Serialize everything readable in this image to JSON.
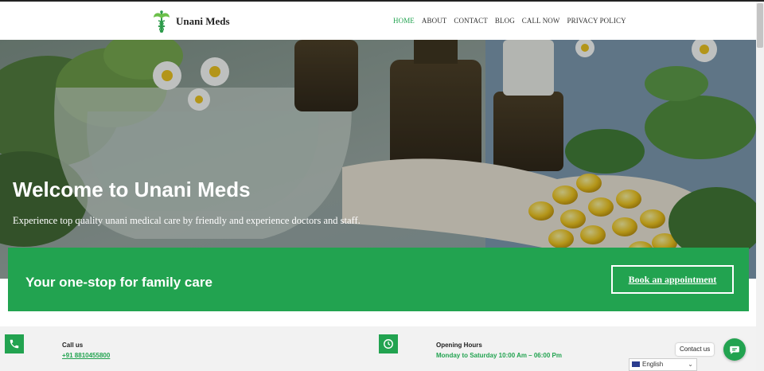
{
  "header": {
    "brand": "Unani Meds",
    "nav": [
      {
        "label": "HOME",
        "active": true
      },
      {
        "label": "ABOUT",
        "active": false
      },
      {
        "label": "CONTACT",
        "active": false
      },
      {
        "label": "BLOG",
        "active": false
      },
      {
        "label": "CALL NOW",
        "active": false
      },
      {
        "label": "PRIVACY POLICY",
        "active": false
      }
    ]
  },
  "hero": {
    "title": "Welcome to Unani Meds",
    "subtitle": "Experience top quality unani medical care by friendly and experience doctors and staff."
  },
  "cta": {
    "text": "Your one-stop for family care",
    "button": "Book an appointment"
  },
  "info": {
    "call": {
      "label": "Call us",
      "value": "+91 8810455800",
      "icon": "phone-icon"
    },
    "hours": {
      "label": "Opening Hours",
      "value": "Monday to Saturday 10:00 Am – 06:00 Pm",
      "icon": "clock-icon"
    }
  },
  "widgets": {
    "contact_label": "Contact us",
    "language": "English"
  },
  "colors": {
    "accent": "#22a350",
    "text": "#222222"
  }
}
